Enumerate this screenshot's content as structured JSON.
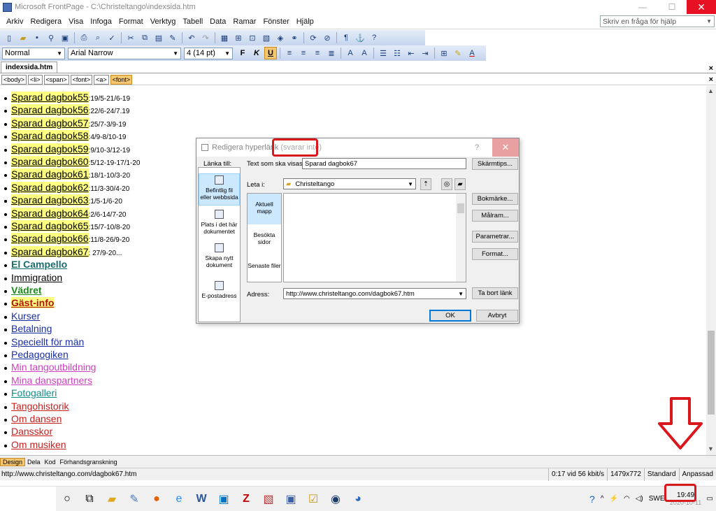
{
  "window": {
    "title": "Microsoft FrontPage - C:\\Christeltango\\indexsida.htm"
  },
  "menu": [
    "Arkiv",
    "Redigera",
    "Visa",
    "Infoga",
    "Format",
    "Verktyg",
    "Tabell",
    "Data",
    "Ramar",
    "Fönster",
    "Hjälp"
  ],
  "help_placeholder": "Skriv en fråga för hjälp",
  "formatting": {
    "style": "Normal",
    "font": "Arial Narrow",
    "size": "4  (14 pt)"
  },
  "doc_tab": "indexsida.htm",
  "tags": [
    "<body>",
    "<li>",
    "<span>",
    "<font>",
    "<a>",
    "<font>"
  ],
  "list_items": [
    {
      "label": "Sparad dagbok55",
      "dates": ":19/5-21/6-19",
      "hl": true,
      "color": "#000000"
    },
    {
      "label": "Sparad dagbok56",
      "dates": ":22/6-24/7.19",
      "hl": true,
      "color": "#000000"
    },
    {
      "label": "Sparad dagbok57",
      "dates": ":25/7-3/9-19",
      "hl": true,
      "color": "#000000"
    },
    {
      "label": "Sparad dagbok58",
      "dates": ":4/9-8/10-19",
      "hl": true,
      "color": "#000000"
    },
    {
      "label": "Sparad dagbok59",
      "dates": ":9/10-3/12-19",
      "hl": true,
      "color": "#000000"
    },
    {
      "label": "Sparad dagbok60",
      "dates": ":5/12-19-17/1-20",
      "hl": true,
      "color": "#000000"
    },
    {
      "label": "Sparad dagbok61",
      "dates": ":18/1-10/3-20",
      "hl": true,
      "color": "#000000"
    },
    {
      "label": "Sparad dagbok62",
      "dates": ":11/3-30/4-20",
      "hl": true,
      "color": "#000000"
    },
    {
      "label": "Sparad dagbok63",
      "dates": ":1/5-1/6-20",
      "hl": true,
      "color": "#000000"
    },
    {
      "label": "Sparad dagbok64",
      "dates": ":2/6-14/7-20",
      "hl": true,
      "color": "#000000"
    },
    {
      "label": "Sparad dagbok65",
      "dates": ":15/7-10/8-20",
      "hl": true,
      "color": "#000000"
    },
    {
      "label": "Sparad dagbok66",
      "dates": ":11/8-26/9-20",
      "hl": true,
      "color": "#000000"
    },
    {
      "label": "Sparad dagbok67",
      "dates": ": 27/9-20...",
      "hl": true,
      "color": "#000000"
    },
    {
      "label": "El Campello",
      "dates": "",
      "hl": false,
      "color": "#1a6b6b",
      "bold": true
    },
    {
      "label": "Immigration",
      "dates": "",
      "hl": false,
      "color": "#000000"
    },
    {
      "label": "Vädret",
      "dates": "",
      "hl": false,
      "color": "#1a8a1a",
      "bold": true
    },
    {
      "label": "Gäst-info",
      "dates": "",
      "hl": true,
      "color": "#b01010",
      "bold": true
    },
    {
      "label": "Kurser",
      "dates": "",
      "hl": false,
      "color": "#1a2ea0"
    },
    {
      "label": "Betalning",
      "dates": "",
      "hl": false,
      "color": "#1a2ea0"
    },
    {
      "label": "Speciellt för män",
      "dates": "",
      "hl": false,
      "color": "#1a2ea0"
    },
    {
      "label": "Pedagogiken",
      "dates": "",
      "hl": false,
      "color": "#1a2ea0"
    },
    {
      "label": "Min tangoutbildning",
      "dates": "",
      "hl": false,
      "color": "#d040c0"
    },
    {
      "label": "Mina danspartners",
      "dates": "",
      "hl": false,
      "color": "#d040c0"
    },
    {
      "label": "Fotogalleri",
      "dates": "",
      "hl": false,
      "color": "#10908a"
    },
    {
      "label": "Tangohistorik",
      "dates": "",
      "hl": false,
      "color": "#c82020"
    },
    {
      "label": "Om dansen",
      "dates": "",
      "hl": false,
      "color": "#c82020"
    },
    {
      "label": "Dansskor",
      "dates": "",
      "hl": false,
      "color": "#c82020"
    },
    {
      "label": "Om musiken",
      "dates": "",
      "hl": false,
      "color": "#c82020"
    }
  ],
  "dialog": {
    "title": "Redigera hyperlänk",
    "not_responding": "(svarar inte)",
    "link_to": "Länka till:",
    "link_to_items": [
      "Befintlig fil eller webbsida",
      "Plats i det här dokumentet",
      "Skapa nytt dokument",
      "E-postadress"
    ],
    "text_label": "Text som ska visas:",
    "text_value": "Sparad dagbok67",
    "lookin_label": "Leta i:",
    "lookin_value": "Christeltango",
    "subnav": [
      "Aktuell mapp",
      "Besökta sidor",
      "Senaste filer"
    ],
    "address_label": "Adress:",
    "address_value": "http://www.christeltango.com/dagbok67.htm",
    "buttons": {
      "screentip": "Skärmtips...",
      "bookmark": "Bokmärke...",
      "target": "Målram...",
      "params": "Parametrar...",
      "style": "Format...",
      "remove": "Ta bort länk",
      "ok": "OK",
      "cancel": "Avbryt"
    }
  },
  "viewbar": [
    "Design",
    "Dela",
    "Kod",
    "Förhandsgranskning"
  ],
  "status": {
    "url": "http://www.christeltango.com/dagbok67.htm",
    "speed": "0:17 vid 56 kbit/s",
    "size": "1479x772",
    "mode": "Standard",
    "custom": "Anpassad"
  },
  "taskbar": {
    "lang": "SWE",
    "time": "19:49",
    "date": "2020-10-11"
  }
}
